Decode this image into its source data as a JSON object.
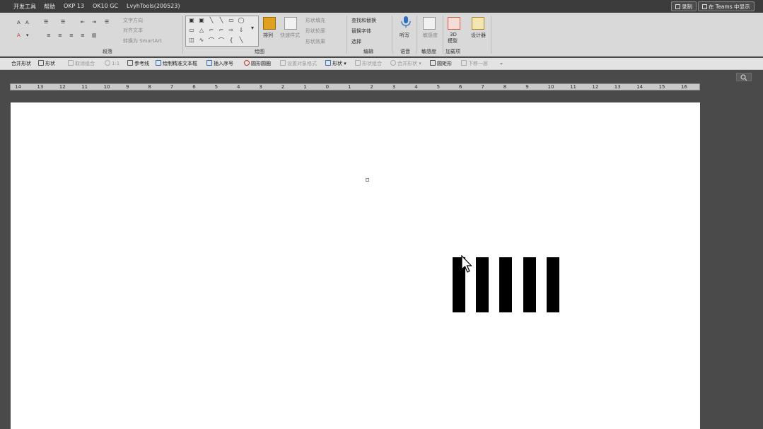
{
  "tabs": [
    "开发工具",
    "帮助",
    "OKP 13",
    "OK10 GC",
    "LvyhTools(200523)"
  ],
  "top_buttons": {
    "record": "录制",
    "teams": "在 Teams 中显示"
  },
  "ribbon": {
    "groups": {
      "paragraph": "段落",
      "drawing": "绘图",
      "editing": "编辑",
      "voice": "语音",
      "sensitivity": "敏感度",
      "addins": "加载项"
    },
    "text_direction": "文字方向",
    "align_text": "对齐文本",
    "convert_smartart": "转换为 SmartArt",
    "arrange": "排列",
    "quick_styles": "快速样式",
    "shape_fill": "形状填充",
    "shape_outline": "形状轮廓",
    "shape_effects": "形状效果",
    "find_replace": "查找和替换",
    "replace_font": "替换字体",
    "select": "选择",
    "dictate": "听写",
    "sensitivity_btn": "敏感度",
    "addin_3d": "3D",
    "addin_3d_sub": "模型",
    "addin_misc": "设计器"
  },
  "quickbar": {
    "items": [
      {
        "label": "合并形状",
        "dim": false
      },
      {
        "label": "形状",
        "dim": false
      },
      {
        "label": "取消组合",
        "dim": true
      },
      {
        "label": "1:1",
        "dim": true
      },
      {
        "label": "参考线",
        "dim": false
      },
      {
        "label": "绘制精准文本框",
        "dim": false
      },
      {
        "label": "插入序号",
        "dim": false
      },
      {
        "label": "圆形圆圈",
        "dim": false
      },
      {
        "label": "设置对象格式",
        "dim": true
      },
      {
        "label": "形状",
        "dim": false
      },
      {
        "label": "形状组合",
        "dim": true
      },
      {
        "label": "合并形状",
        "dim": true
      },
      {
        "label": "圆矩形",
        "dim": false
      },
      {
        "label": "下移一层",
        "dim": true
      }
    ]
  },
  "ruler_labels": [
    "14",
    "13",
    "12",
    "11",
    "10",
    "9",
    "8",
    "7",
    "6",
    "5",
    "4",
    "3",
    "2",
    "1",
    "0",
    "1",
    "2",
    "3",
    "4",
    "5",
    "6",
    "7",
    "8",
    "9",
    "10",
    "11",
    "12",
    "13",
    "14",
    "15",
    "16"
  ],
  "document": {
    "stripe_count": 5,
    "stripe_color": "#000000"
  },
  "colors": {
    "tabbar": "#3c3c3c",
    "ribbon": "#d9d9d9",
    "workspace": "#4a4a4a",
    "page": "#ffffff"
  },
  "icons": [
    "cursor-icon",
    "search-icon",
    "microphone-icon",
    "record-icon",
    "teams-icon"
  ]
}
